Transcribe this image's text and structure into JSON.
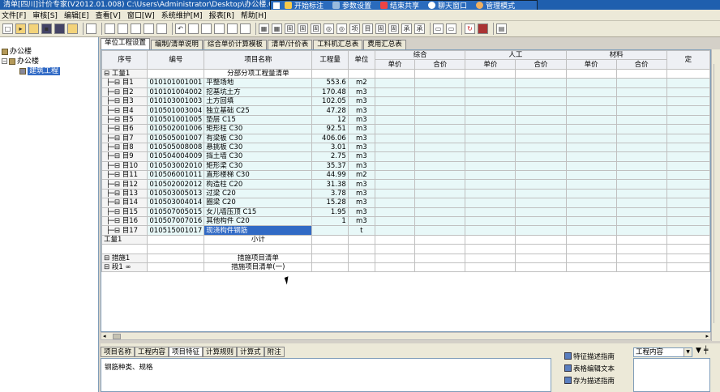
{
  "window": {
    "title": "清单[四川]计价专家(V2012.01.008) C:\\Users\\Administrator\\Desktop\\办公楼.GC"
  },
  "float_toolbar": [
    {
      "label": "开始标注",
      "icon": "pen-icon"
    },
    {
      "label": "参数设置",
      "icon": "settings-icon"
    },
    {
      "label": "结束共享",
      "icon": "stop-icon"
    },
    {
      "label": "聊天窗口",
      "icon": "chat-icon"
    },
    {
      "label": "管理模式",
      "icon": "user-icon"
    }
  ],
  "menu": [
    "文件[F]",
    "审核[S]",
    "编辑[E]",
    "查看[V]",
    "窗口[W]",
    "系统维护[M]",
    "报表[R]",
    "帮助[H]"
  ],
  "tree": {
    "root": "办公楼",
    "child": "办公楼",
    "leaf": "建筑工程"
  },
  "tabs": [
    "单位工程设置",
    "编制/清单说明",
    "综合单价计算模板",
    "清单/计价表",
    "工料机汇总表",
    "费用汇总表"
  ],
  "grid": {
    "headers": {
      "seq": "序号",
      "code": "编号",
      "name": "项目名称",
      "qty": "工程量",
      "unit": "单位",
      "group1": "综合",
      "group2": "人工",
      "group3": "材料",
      "price": "单价",
      "total": "合价",
      "cut": "定"
    },
    "top": {
      "seq": "工量1",
      "name": "分部分项工程量清单"
    },
    "rows": [
      {
        "seq": "目1",
        "code": "010101001001",
        "name": "平整场地",
        "qty": "553.6",
        "unit": "m2"
      },
      {
        "seq": "目2",
        "code": "010101004002",
        "name": "挖基坑土方",
        "qty": "170.48",
        "unit": "m3"
      },
      {
        "seq": "目3",
        "code": "010103001003",
        "name": "土方回填",
        "qty": "102.05",
        "unit": "m3"
      },
      {
        "seq": "目4",
        "code": "010501003004",
        "name": "独立基础 C25",
        "qty": "47.28",
        "unit": "m3"
      },
      {
        "seq": "目5",
        "code": "010501001005",
        "name": "垫层 C15",
        "qty": "12",
        "unit": "m3"
      },
      {
        "seq": "目6",
        "code": "010502001006",
        "name": "矩形柱 C30",
        "qty": "92.51",
        "unit": "m3"
      },
      {
        "seq": "目7",
        "code": "010505001007",
        "name": "有梁板 C30",
        "qty": "406.06",
        "unit": "m3"
      },
      {
        "seq": "目8",
        "code": "010505008008",
        "name": "悬挑板 C30",
        "qty": "3.01",
        "unit": "m3"
      },
      {
        "seq": "目9",
        "code": "010504004009",
        "name": "挡土墙 C30",
        "qty": "2.75",
        "unit": "m3"
      },
      {
        "seq": "目10",
        "code": "010503002010",
        "name": "矩形梁 C30",
        "qty": "35.37",
        "unit": "m3"
      },
      {
        "seq": "目11",
        "code": "010506001011",
        "name": "直形楼梯 C30",
        "qty": "44.99",
        "unit": "m2"
      },
      {
        "seq": "目12",
        "code": "010502002012",
        "name": "构造柱 C20",
        "qty": "31.38",
        "unit": "m3"
      },
      {
        "seq": "目13",
        "code": "010503005013",
        "name": "过梁 C20",
        "qty": "3.78",
        "unit": "m3"
      },
      {
        "seq": "目14",
        "code": "010503004014",
        "name": "圈梁 C20",
        "qty": "15.28",
        "unit": "m3"
      },
      {
        "seq": "目15",
        "code": "010507005015",
        "name": "女儿墙压顶 C15",
        "qty": "1.95",
        "unit": "m3"
      },
      {
        "seq": "目16",
        "code": "010507007016",
        "name": "其他构件 C20",
        "qty": "1",
        "unit": "m3"
      },
      {
        "seq": "目17",
        "code": "010515001017",
        "name": "现浇构件钢筋",
        "qty": "",
        "unit": "t"
      }
    ],
    "subtotal": {
      "seq": "工量1",
      "name": "小计"
    },
    "measures": {
      "seq": "措施1",
      "name": "措施项目清单"
    },
    "measures_sub": {
      "seq": "段1 ∞",
      "name": "措施项目清单(一)"
    }
  },
  "bottom": {
    "tabs": [
      "项目名称",
      "工程内容",
      "项目特征",
      "计算规则",
      "计算式",
      "附注"
    ],
    "active_tab": "项目特征",
    "text": "钢筋种类、规格",
    "buttons": [
      "特征描述指南",
      "表格编辑文本",
      "存为描述指南"
    ],
    "select_value": "工程内容"
  }
}
